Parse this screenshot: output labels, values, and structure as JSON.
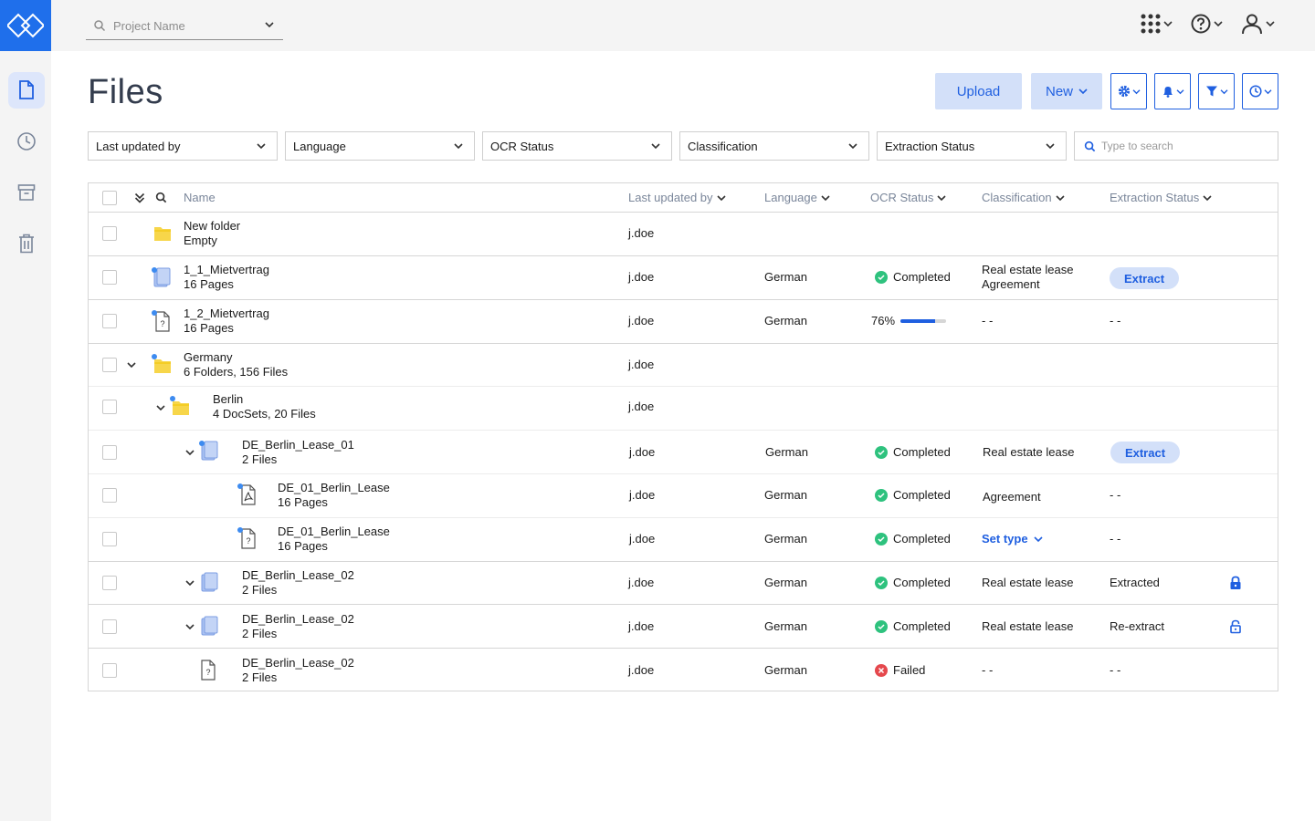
{
  "header": {
    "project_placeholder": "Project Name"
  },
  "page": {
    "title": "Files",
    "upload_label": "Upload",
    "new_label": "New"
  },
  "filters": {
    "last_updated_by": "Last updated by",
    "language": "Language",
    "ocr_status": "OCR Status",
    "classification": "Classification",
    "extraction_status": "Extraction Status",
    "search_placeholder": "Type to search"
  },
  "columns": {
    "name": "Name",
    "last_updated_by": "Last updated by",
    "language": "Language",
    "ocr_status": "OCR Status",
    "classification": "Classification",
    "extraction_status": "Extraction Status"
  },
  "colors": {
    "accent": "#1f5fe0",
    "success": "#2ec27e",
    "failed": "#e5484d",
    "folder": "#f7d64a"
  },
  "rows": [
    {
      "name": "New folder",
      "sub": "Empty",
      "user": "j.doe",
      "language": "",
      "ocr": "",
      "class1": "",
      "class2": "",
      "extraction": ""
    },
    {
      "name": "1_1_Mietvertrag",
      "sub": "16 Pages",
      "user": "j.doe",
      "language": "German",
      "ocr": "Completed",
      "class1": "Real estate lease",
      "class2": "Agreement",
      "extraction": "Extract"
    },
    {
      "name": "1_2_Mietvertrag",
      "sub": "16 Pages",
      "user": "j.doe",
      "language": "German",
      "ocr": "76%",
      "ocr_progress": 0.76,
      "class1": "- -",
      "class2": "",
      "extraction": "- -"
    },
    {
      "name": "Germany",
      "sub": "6 Folders,  156 Files",
      "user": "j.doe",
      "language": "",
      "ocr": "",
      "class1": "",
      "class2": "",
      "extraction": ""
    },
    {
      "name": "Berlin",
      "sub": "4 DocSets, 20 Files",
      "user": "j.doe",
      "language": "",
      "ocr": "",
      "class1": "",
      "class2": "",
      "extraction": ""
    },
    {
      "name": "DE_Berlin_Lease_01",
      "sub": "2 Files",
      "user": "j.doe",
      "language": "German",
      "ocr": "Completed",
      "class1": "Real estate lease",
      "class2": "",
      "extraction": "Extract"
    },
    {
      "name": "DE_01_Berlin_Lease",
      "sub": "16 Pages",
      "user": "j.doe",
      "language": "German",
      "ocr": "Completed",
      "class1": "Agreement",
      "class2": "",
      "extraction": "- -"
    },
    {
      "name": "DE_01_Berlin_Lease",
      "sub": "16 Pages",
      "user": "j.doe",
      "language": "German",
      "ocr": "Completed",
      "class1": "Set type",
      "class2": "",
      "extraction": "- -"
    },
    {
      "name": "DE_Berlin_Lease_02",
      "sub": "2 Files",
      "user": "j.doe",
      "language": "German",
      "ocr": "Completed",
      "class1": "Real estate lease",
      "class2": "",
      "extraction": "Extracted"
    },
    {
      "name": "DE_Berlin_Lease_02",
      "sub": "2 Files",
      "user": "j.doe",
      "language": "German",
      "ocr": "Completed",
      "class1": "Real estate lease",
      "class2": "",
      "extraction": "Re-extract"
    },
    {
      "name": "DE_Berlin_Lease_02",
      "sub": "2 Files",
      "user": "j.doe",
      "language": "German",
      "ocr": "Failed",
      "class1": "- -",
      "class2": "",
      "extraction": "- -"
    }
  ]
}
